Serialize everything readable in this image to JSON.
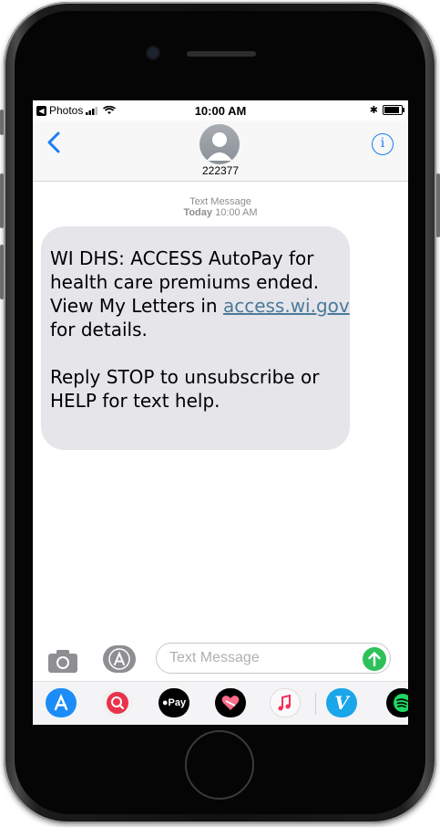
{
  "status_bar": {
    "back_app": "Photos",
    "time": "10:00 AM"
  },
  "header": {
    "contact": "222377"
  },
  "conversation": {
    "service_label": "Text Message",
    "day": "Today",
    "time": "10:00 AM",
    "message_part1": "WI DHS: ACCESS AutoPay for health care premiums ended. View My Letters in ",
    "message_link": "access.wi.gov",
    "message_part2": " for details.",
    "message_part3": "Reply STOP to unsubscribe or HELP for text help."
  },
  "compose": {
    "placeholder": "Text Message"
  },
  "apps": {
    "apple_pay": "Pay",
    "vimeo": "V"
  },
  "colors": {
    "accent": "#1a7cf5",
    "bubble_gray": "#e5e5ea",
    "link": "#4b7a9a",
    "send_green": "#2ec15a"
  }
}
